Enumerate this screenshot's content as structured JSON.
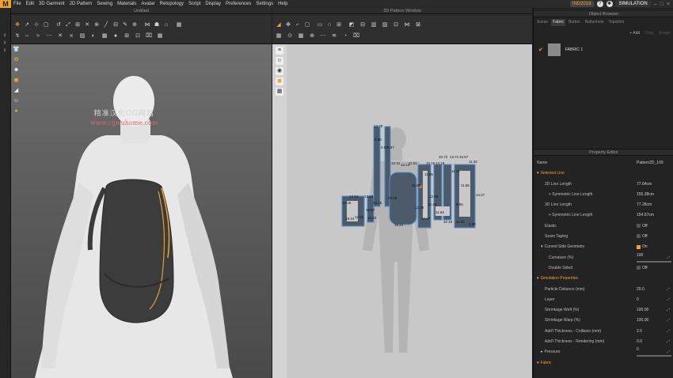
{
  "menu": {
    "items": [
      "File",
      "Edit",
      "3D Garment",
      "2D Pattern",
      "Sewing",
      "Materials",
      "Avatar",
      "Retopology",
      "Script",
      "Display",
      "Preferences",
      "Settings",
      "Help"
    ],
    "user_badge": "IND2018",
    "simulation_label": "SIMULATION"
  },
  "panels": {
    "view3d_title": "Untitled",
    "view2d_title": "2D Pattern Window",
    "object_browser_title": "Object Browser",
    "property_editor_title": "Property Editor"
  },
  "watermark": {
    "line1": "精准汉化CG网站",
    "line2": "www.cgwuhome.com"
  },
  "object_browser": {
    "tabs": [
      "Scene",
      "Fabric",
      "Button",
      "Buttonhole",
      "Topstitch"
    ],
    "active_tab": "Fabric",
    "actions": [
      "+ Add",
      "Copy",
      "Assign"
    ],
    "fabric_item": "FABRIC 1"
  },
  "property_editor": {
    "rows": [
      {
        "key": "Name",
        "value": "Pattern2D_169",
        "type": "plain",
        "indent": 0
      },
      {
        "key": "Selected Line",
        "value": "",
        "type": "section",
        "indent": 0
      },
      {
        "key": "2D Line Length",
        "value": "77.64cm",
        "type": "plain",
        "indent": 2
      },
      {
        "key": "+ Symmetric Line Length",
        "value": "155.28cm",
        "type": "plain",
        "indent": 3
      },
      {
        "key": "3D Line Length",
        "value": "77.28cm",
        "type": "plain",
        "indent": 2
      },
      {
        "key": "+ Symmetric Line Length",
        "value": "154.57cm",
        "type": "plain",
        "indent": 3
      },
      {
        "key": "Elastic",
        "value": "Off",
        "type": "check",
        "indent": 2
      },
      {
        "key": "Seam Taping",
        "value": "Off",
        "type": "check",
        "indent": 2
      },
      {
        "key": "Curved Side Geometry",
        "value": "On",
        "type": "checkon",
        "indent": 1
      },
      {
        "key": "Curvature (%)",
        "value": "100",
        "type": "slider",
        "indent": 3
      },
      {
        "key": "Double Sided",
        "value": "Off",
        "type": "check",
        "indent": 3
      },
      {
        "key": "Simulation Properties",
        "value": "",
        "type": "section",
        "indent": 0
      },
      {
        "key": "Particle Distance (mm)",
        "value": "20.0",
        "type": "edit",
        "indent": 2
      },
      {
        "key": "Layer",
        "value": "0",
        "type": "edit",
        "indent": 2
      },
      {
        "key": "Shrinkage Weft (%)",
        "value": "100.00",
        "type": "edit",
        "indent": 2
      },
      {
        "key": "Shrinkage Warp (%)",
        "value": "100.00",
        "type": "edit",
        "indent": 2
      },
      {
        "key": "Add'l Thickness - Collision (mm)",
        "value": "2.5",
        "type": "edit",
        "indent": 2
      },
      {
        "key": "Add'l Thickness - Rendering (mm)",
        "value": "0.0",
        "type": "edit",
        "indent": 2
      },
      {
        "key": "Pressure",
        "value": "0",
        "type": "slider",
        "indent": 1
      },
      {
        "key": "Fabric",
        "value": "",
        "type": "section",
        "indent": 0
      }
    ]
  },
  "pattern_labels": [
    "13.79",
    "0.50",
    "0.67",
    "10.72",
    "13.71",
    "10.67",
    "9.67",
    "13.12",
    "13.13",
    "11.51",
    "10.16",
    "13.19",
    "11.32",
    "11.41",
    "11.55",
    "12.04",
    "13.58",
    "12.18",
    "12.18",
    "14.27",
    "20.18",
    "12.63",
    "9.56",
    "11.62",
    "13.43",
    "15.67",
    "12.27",
    "18.44",
    "12.83",
    "19.21",
    "8.28",
    "10.18",
    "11.02",
    "12.29",
    "11.86",
    "21.85",
    "13.49"
  ]
}
